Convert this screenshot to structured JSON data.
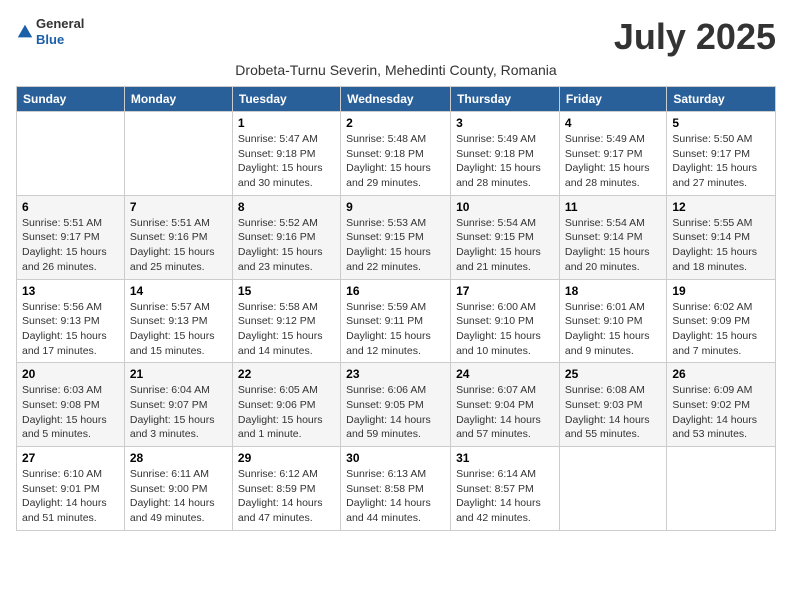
{
  "header": {
    "logo_general": "General",
    "logo_blue": "Blue",
    "month_title": "July 2025",
    "subtitle": "Drobeta-Turnu Severin, Mehedinti County, Romania"
  },
  "weekdays": [
    "Sunday",
    "Monday",
    "Tuesday",
    "Wednesday",
    "Thursday",
    "Friday",
    "Saturday"
  ],
  "weeks": [
    [
      {
        "day": "",
        "sunrise": "",
        "sunset": "",
        "daylight": ""
      },
      {
        "day": "",
        "sunrise": "",
        "sunset": "",
        "daylight": ""
      },
      {
        "day": "1",
        "sunrise": "Sunrise: 5:47 AM",
        "sunset": "Sunset: 9:18 PM",
        "daylight": "Daylight: 15 hours and 30 minutes."
      },
      {
        "day": "2",
        "sunrise": "Sunrise: 5:48 AM",
        "sunset": "Sunset: 9:18 PM",
        "daylight": "Daylight: 15 hours and 29 minutes."
      },
      {
        "day": "3",
        "sunrise": "Sunrise: 5:49 AM",
        "sunset": "Sunset: 9:18 PM",
        "daylight": "Daylight: 15 hours and 28 minutes."
      },
      {
        "day": "4",
        "sunrise": "Sunrise: 5:49 AM",
        "sunset": "Sunset: 9:17 PM",
        "daylight": "Daylight: 15 hours and 28 minutes."
      },
      {
        "day": "5",
        "sunrise": "Sunrise: 5:50 AM",
        "sunset": "Sunset: 9:17 PM",
        "daylight": "Daylight: 15 hours and 27 minutes."
      }
    ],
    [
      {
        "day": "6",
        "sunrise": "Sunrise: 5:51 AM",
        "sunset": "Sunset: 9:17 PM",
        "daylight": "Daylight: 15 hours and 26 minutes."
      },
      {
        "day": "7",
        "sunrise": "Sunrise: 5:51 AM",
        "sunset": "Sunset: 9:16 PM",
        "daylight": "Daylight: 15 hours and 25 minutes."
      },
      {
        "day": "8",
        "sunrise": "Sunrise: 5:52 AM",
        "sunset": "Sunset: 9:16 PM",
        "daylight": "Daylight: 15 hours and 23 minutes."
      },
      {
        "day": "9",
        "sunrise": "Sunrise: 5:53 AM",
        "sunset": "Sunset: 9:15 PM",
        "daylight": "Daylight: 15 hours and 22 minutes."
      },
      {
        "day": "10",
        "sunrise": "Sunrise: 5:54 AM",
        "sunset": "Sunset: 9:15 PM",
        "daylight": "Daylight: 15 hours and 21 minutes."
      },
      {
        "day": "11",
        "sunrise": "Sunrise: 5:54 AM",
        "sunset": "Sunset: 9:14 PM",
        "daylight": "Daylight: 15 hours and 20 minutes."
      },
      {
        "day": "12",
        "sunrise": "Sunrise: 5:55 AM",
        "sunset": "Sunset: 9:14 PM",
        "daylight": "Daylight: 15 hours and 18 minutes."
      }
    ],
    [
      {
        "day": "13",
        "sunrise": "Sunrise: 5:56 AM",
        "sunset": "Sunset: 9:13 PM",
        "daylight": "Daylight: 15 hours and 17 minutes."
      },
      {
        "day": "14",
        "sunrise": "Sunrise: 5:57 AM",
        "sunset": "Sunset: 9:13 PM",
        "daylight": "Daylight: 15 hours and 15 minutes."
      },
      {
        "day": "15",
        "sunrise": "Sunrise: 5:58 AM",
        "sunset": "Sunset: 9:12 PM",
        "daylight": "Daylight: 15 hours and 14 minutes."
      },
      {
        "day": "16",
        "sunrise": "Sunrise: 5:59 AM",
        "sunset": "Sunset: 9:11 PM",
        "daylight": "Daylight: 15 hours and 12 minutes."
      },
      {
        "day": "17",
        "sunrise": "Sunrise: 6:00 AM",
        "sunset": "Sunset: 9:10 PM",
        "daylight": "Daylight: 15 hours and 10 minutes."
      },
      {
        "day": "18",
        "sunrise": "Sunrise: 6:01 AM",
        "sunset": "Sunset: 9:10 PM",
        "daylight": "Daylight: 15 hours and 9 minutes."
      },
      {
        "day": "19",
        "sunrise": "Sunrise: 6:02 AM",
        "sunset": "Sunset: 9:09 PM",
        "daylight": "Daylight: 15 hours and 7 minutes."
      }
    ],
    [
      {
        "day": "20",
        "sunrise": "Sunrise: 6:03 AM",
        "sunset": "Sunset: 9:08 PM",
        "daylight": "Daylight: 15 hours and 5 minutes."
      },
      {
        "day": "21",
        "sunrise": "Sunrise: 6:04 AM",
        "sunset": "Sunset: 9:07 PM",
        "daylight": "Daylight: 15 hours and 3 minutes."
      },
      {
        "day": "22",
        "sunrise": "Sunrise: 6:05 AM",
        "sunset": "Sunset: 9:06 PM",
        "daylight": "Daylight: 15 hours and 1 minute."
      },
      {
        "day": "23",
        "sunrise": "Sunrise: 6:06 AM",
        "sunset": "Sunset: 9:05 PM",
        "daylight": "Daylight: 14 hours and 59 minutes."
      },
      {
        "day": "24",
        "sunrise": "Sunrise: 6:07 AM",
        "sunset": "Sunset: 9:04 PM",
        "daylight": "Daylight: 14 hours and 57 minutes."
      },
      {
        "day": "25",
        "sunrise": "Sunrise: 6:08 AM",
        "sunset": "Sunset: 9:03 PM",
        "daylight": "Daylight: 14 hours and 55 minutes."
      },
      {
        "day": "26",
        "sunrise": "Sunrise: 6:09 AM",
        "sunset": "Sunset: 9:02 PM",
        "daylight": "Daylight: 14 hours and 53 minutes."
      }
    ],
    [
      {
        "day": "27",
        "sunrise": "Sunrise: 6:10 AM",
        "sunset": "Sunset: 9:01 PM",
        "daylight": "Daylight: 14 hours and 51 minutes."
      },
      {
        "day": "28",
        "sunrise": "Sunrise: 6:11 AM",
        "sunset": "Sunset: 9:00 PM",
        "daylight": "Daylight: 14 hours and 49 minutes."
      },
      {
        "day": "29",
        "sunrise": "Sunrise: 6:12 AM",
        "sunset": "Sunset: 8:59 PM",
        "daylight": "Daylight: 14 hours and 47 minutes."
      },
      {
        "day": "30",
        "sunrise": "Sunrise: 6:13 AM",
        "sunset": "Sunset: 8:58 PM",
        "daylight": "Daylight: 14 hours and 44 minutes."
      },
      {
        "day": "31",
        "sunrise": "Sunrise: 6:14 AM",
        "sunset": "Sunset: 8:57 PM",
        "daylight": "Daylight: 14 hours and 42 minutes."
      },
      {
        "day": "",
        "sunrise": "",
        "sunset": "",
        "daylight": ""
      },
      {
        "day": "",
        "sunrise": "",
        "sunset": "",
        "daylight": ""
      }
    ]
  ]
}
